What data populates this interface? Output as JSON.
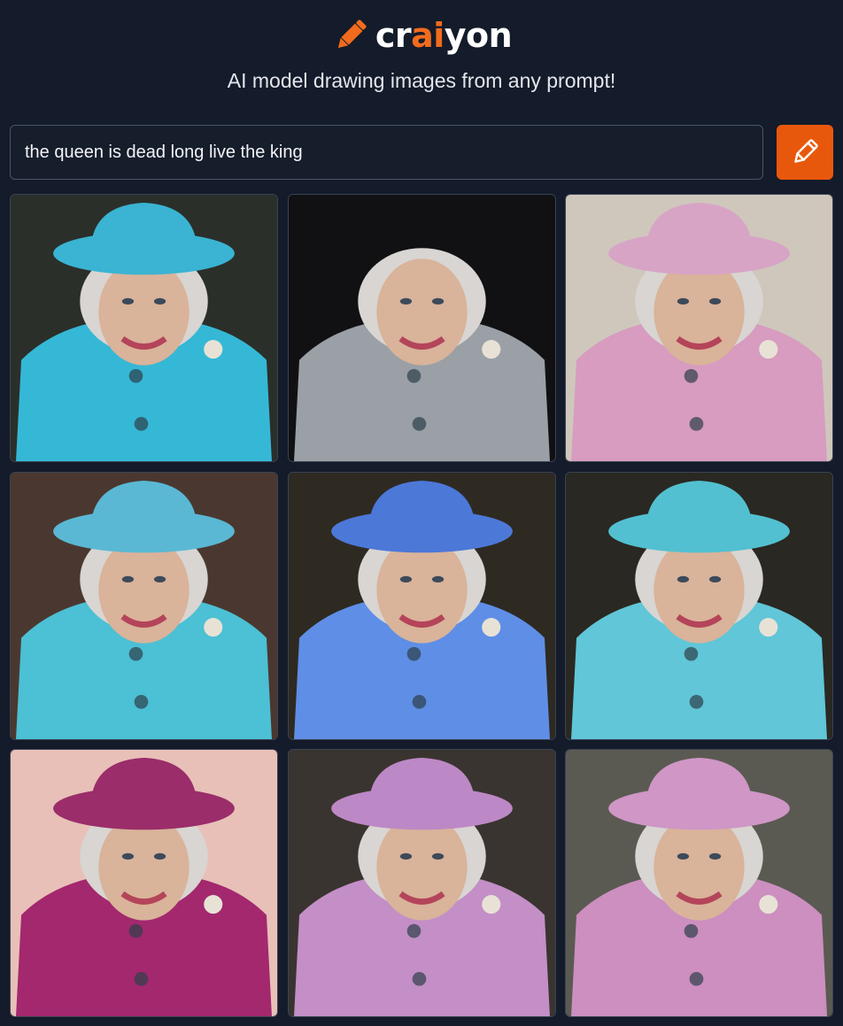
{
  "brand": {
    "name_prefix": "cr",
    "name_highlight": "ai",
    "name_suffix": "yon",
    "icon": "pencil-icon",
    "accent_color": "#f26b1d"
  },
  "tagline": "AI model drawing images from any prompt!",
  "prompt": {
    "value": "the queen is dead long live the king"
  },
  "draw_button": {
    "icon": "pencil-icon",
    "color": "#e8580c"
  },
  "results": [
    {
      "outfit_color": "#35b8d6",
      "hat_color": "#3ab4d2",
      "background": "#2b2f2a"
    },
    {
      "outfit_color": "#9aa0a6",
      "hat_color": "#d9d9d9",
      "background": "#111114"
    },
    {
      "outfit_color": "#d79cbf",
      "hat_color": "#d7a4c6",
      "background": "#cfc7bc"
    },
    {
      "outfit_color": "#4cc0d4",
      "hat_color": "#5ab8d4",
      "background": "#4a3830"
    },
    {
      "outfit_color": "#5f8ee6",
      "hat_color": "#4c78d8",
      "background": "#2e2a22"
    },
    {
      "outfit_color": "#60c6d8",
      "hat_color": "#52c0d0",
      "background": "#2a2822"
    },
    {
      "outfit_color": "#a3286e",
      "hat_color": "#9a2d6a",
      "background": "#e8c0b8"
    },
    {
      "outfit_color": "#c38fc6",
      "hat_color": "#bd88c6",
      "background": "#3a3430"
    },
    {
      "outfit_color": "#cc8fbf",
      "hat_color": "#cf96c6",
      "background": "#5a5a52"
    }
  ]
}
